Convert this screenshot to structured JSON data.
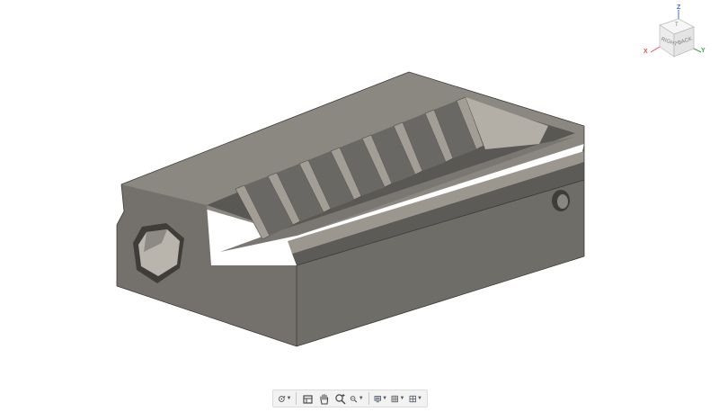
{
  "viewcube": {
    "faces": {
      "right": "RIGHT",
      "back": "BACK",
      "top": "T"
    },
    "axes": {
      "x": "X",
      "y": "Y",
      "z": "Z"
    },
    "axis_colors": {
      "x": "#e05050",
      "y": "#3aa04a",
      "z": "#3f6fd8"
    }
  },
  "model": {
    "colors": {
      "top": "#8a8781",
      "front": "#6a6863",
      "side": "#77746f",
      "dark": "#4d4b47",
      "light": "#a8a49c"
    }
  },
  "toolbar": {
    "icons": [
      "orbit-icon",
      "look-at-icon",
      "pan-icon",
      "zoom-icon",
      "fit-icon",
      "display-settings-icon",
      "grid-settings-icon",
      "viewports-icon"
    ]
  }
}
